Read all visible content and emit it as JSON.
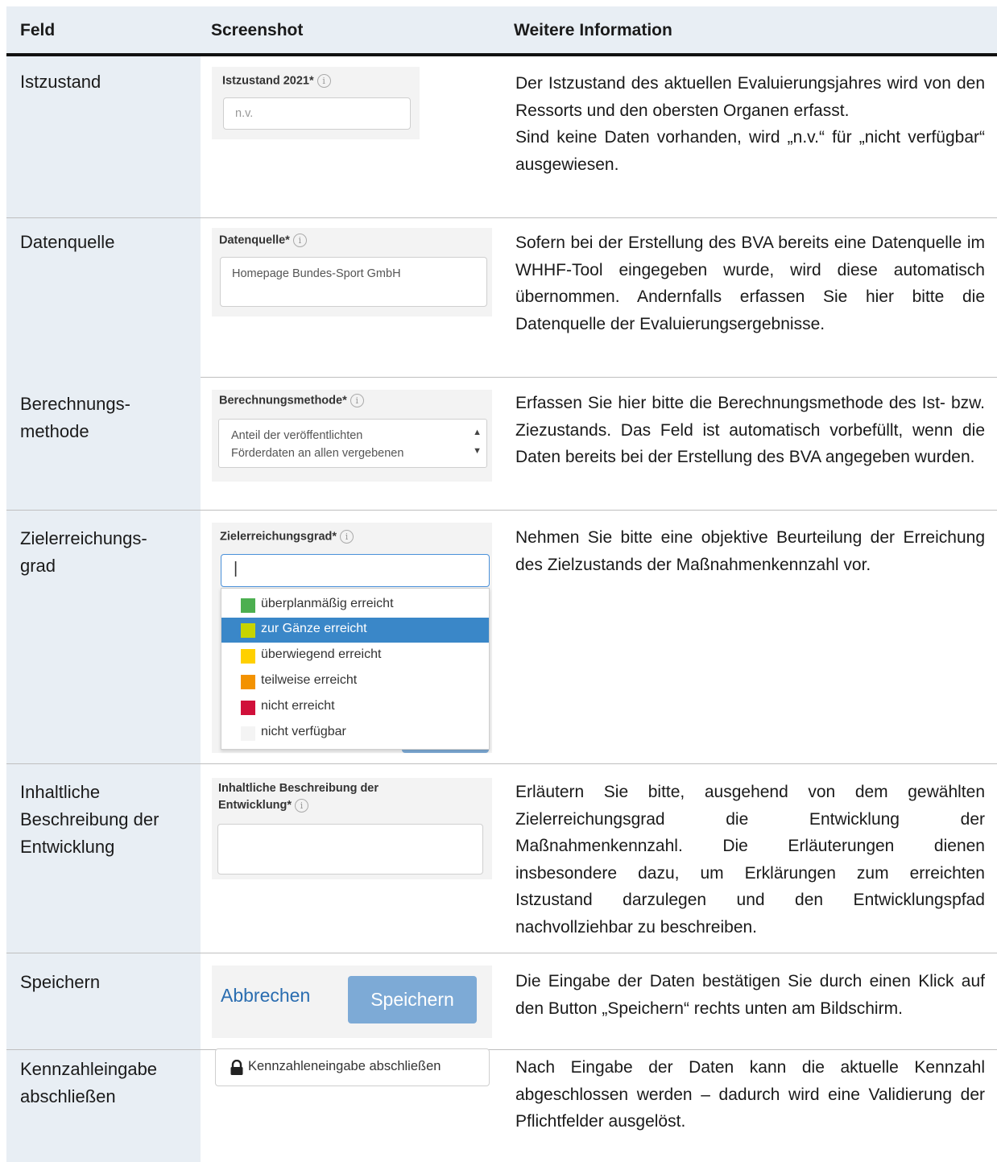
{
  "header": {
    "col1": "Feld",
    "col2": "Screenshot",
    "col3": "Weitere Information"
  },
  "rows": [
    {
      "feld": "Istzustand",
      "shot": {
        "label": "Istzustand 2021*",
        "info_glyph": "i",
        "placeholder": "n.v."
      },
      "info": [
        "Der Istzustand des aktuellen Evaluierungsjahres wird von den Ressorts und den obersten Organen erfasst.",
        "Sind keine Daten vorhanden, wird „n.v.“ für „nicht verfügbar“ ausgewiesen."
      ]
    },
    {
      "feld": "Datenquelle",
      "shot": {
        "label": "Datenquelle*",
        "info_glyph": "i",
        "value": "Homepage Bundes-Sport GmbH"
      },
      "info": [
        "Sofern bei der Erstellung des BVA bereits eine Datenquelle im WHHF-Tool eingegeben wurde, wird diese automatisch übernommen. Andernfalls erfassen Sie hier bitte die Datenquelle der Evaluierungsergebnisse."
      ]
    },
    {
      "feld": "Berechnungs-\nmethode",
      "shot": {
        "label": "Berechnungsmethode*",
        "info_glyph": "i",
        "value_line1": "Anteil der veröffentlichten",
        "value_line2": "Förderdaten an allen vergebenen",
        "scroll_up": "▲",
        "scroll_down": "▼"
      },
      "info": [
        "Erfassen Sie hier bitte die Berechnungsmethode des Ist- bzw. Ziezustands. Das Feld ist automatisch vorbefüllt, wenn die Daten bereits bei der Erstellung des BVA angegeben wurden."
      ]
    },
    {
      "feld": "Zielerreichungs-\ngrad",
      "shot": {
        "label": "Zielerreichungsgrad*",
        "info_glyph": "i",
        "cursor": "|",
        "options": [
          {
            "text": "überplanmäßig erreicht",
            "color": "#4caf50"
          },
          {
            "text": "zur Gänze erreicht",
            "color": "#c7d400"
          },
          {
            "text": "überwiegend erreicht",
            "color": "#ffd000"
          },
          {
            "text": "teilweise erreicht",
            "color": "#f39200"
          },
          {
            "text": "nicht erreicht",
            "color": "#d0103a"
          },
          {
            "text": "nicht verfügbar",
            "color": "#f4f4f4"
          }
        ]
      },
      "info": [
        "Nehmen Sie bitte eine objektive Beurteilung der Erreichung des Zielzustands der Maßnahmenkennzahl vor."
      ]
    },
    {
      "feld": "Inhaltliche\nBeschreibung der\nEntwicklung",
      "shot": {
        "label_line1": "Inhaltliche Beschreibung der",
        "label_line2": "Entwicklung*",
        "info_glyph": "i"
      },
      "info": [
        "Erläutern Sie bitte, ausgehend von dem gewählten Zielerreichungsgrad die Entwicklung der Maßnahmenkennzahl. Die Erläuterungen dienen insbesondere dazu, um Erklärungen zum erreichten Istzustand darzulegen und den Entwicklungspfad nachvollziehbar zu beschreiben."
      ]
    },
    {
      "feld": "Speichern",
      "shot": {
        "cancel": "Abbrechen",
        "save": "Speichern"
      },
      "info": [
        "Die Eingabe der Daten bestätigen Sie durch einen Klick auf den Button „Speichern“ rechts unten am Bildschirm."
      ]
    },
    {
      "feld": "Kennzahleingabe\nabschließen",
      "shot": {
        "button": "Kennzahleneingabe abschließen",
        "icon": "lock-icon"
      },
      "info": [
        "Nach Eingabe der Daten kann die aktuelle Kennzahl abgeschlossen werden – dadurch wird eine Validierung der Pflichtfelder ausgelöst."
      ]
    }
  ]
}
